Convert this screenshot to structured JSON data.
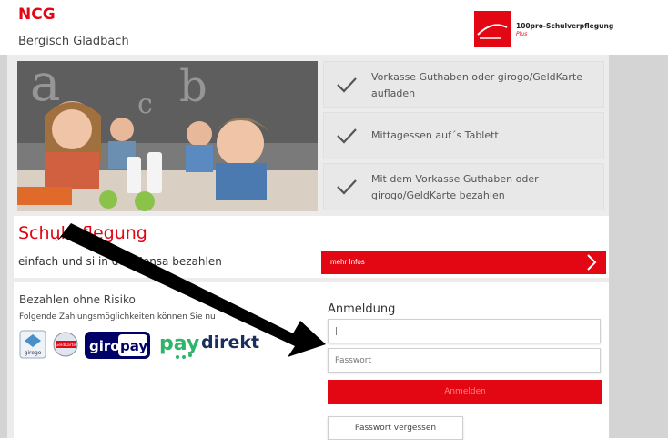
{
  "header": {
    "brand": "NCG",
    "city": "Bergisch Gladbach",
    "logo_text": "100pro-Schulverpflegung",
    "logo_plus": "Plus"
  },
  "features": [
    {
      "text": "Vorkasse Guthaben oder girogo/GeldKarte aufladen"
    },
    {
      "text": "Mittagessen auf´s Tablett"
    },
    {
      "text": "Mit dem Vorkasse Guthaben oder girogo/GeldKarte bezahlen"
    }
  ],
  "hero": {
    "chalk_letters": [
      "a",
      "b",
      "c"
    ]
  },
  "banner": {
    "title": "Schul      pflegung",
    "subtitle": "einfach und si               in der Mensa bezahlen",
    "more_label": "mehr Infos"
  },
  "payment": {
    "title": "Bezahlen ohne Risiko",
    "subtitle": "Folgende Zahlungsmöglichkeiten können Sie nu",
    "logos": {
      "girogo": "girogo",
      "geldkarte": "GeldKarte",
      "giropay_a": "giro",
      "giropay_b": "pay",
      "paydirekt_a": "pay",
      "paydirekt_b": "direkt"
    }
  },
  "login": {
    "title": "Anmeldung",
    "username_value": "|",
    "password_placeholder": "Passwort",
    "login_button": "Anmelden",
    "forgot_button": "Passwort vergessen"
  },
  "colors": {
    "accent": "#e30613",
    "panel_gray": "#ececec",
    "side_gray": "#d4d4d4"
  }
}
